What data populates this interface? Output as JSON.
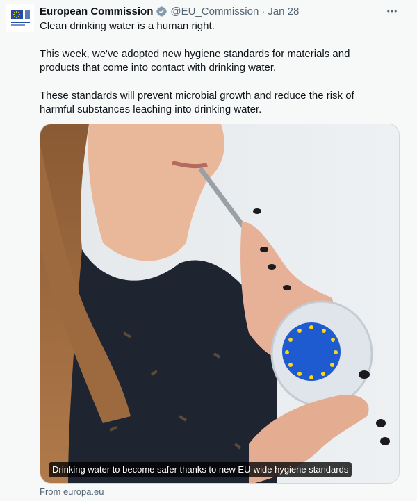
{
  "tweet": {
    "author": "European Commission",
    "handle": "@EU_Commission",
    "separator": "·",
    "date": "Jan 28",
    "paragraphs": [
      "Clean drinking water is a human right.",
      "This week, we've adopted new hygiene standards for materials and\nproducts that come into contact with drinking water.",
      "These standards will prevent microbial growth and reduce the risk of\nharmful substances leaching into drinking water."
    ]
  },
  "media": {
    "caption": "Drinking water to become safer thanks to new EU-wide hygiene standards",
    "source": "From europa.eu"
  },
  "icons": {
    "verified": "verified-badge-icon",
    "more": "more-horizontal-icon",
    "avatar": "eu-flag-logo"
  },
  "colors": {
    "background": "#f7f9f9",
    "text": "#0f1419",
    "secondary": "#536471",
    "verified_blue": "#1d9bf0",
    "eu_blue": "#1f4ea8",
    "eu_gold": "#ffd617"
  }
}
